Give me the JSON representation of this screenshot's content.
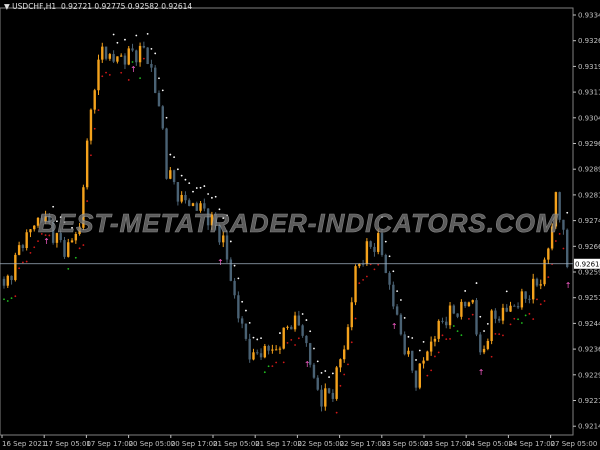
{
  "header": {
    "symbol": "USDCHF,H1",
    "open": "0.92721",
    "high": "0.92775",
    "low": "0.92582",
    "close": "0.92614"
  },
  "watermark": "BEST-METATRADER-INDICATORS.COM",
  "colors": {
    "bull": "#f4a21c",
    "bear": "#4a6274",
    "dot_up": "#ffffff",
    "dot_down": "#d01818",
    "dot_green": "#20c020",
    "signal": "#ff60d0",
    "axis": "#c0c0c0"
  },
  "chart_data": {
    "type": "candlestick",
    "title": "USDCHF,H1",
    "ylim": [
      0.92115,
      0.93365
    ],
    "y_ticks": [
      "0.93340",
      "0.93265",
      "0.93190",
      "0.93115",
      "0.93040",
      "0.92965",
      "0.92890",
      "0.92815",
      "0.92740",
      "0.92665",
      "0.92590",
      "0.92515",
      "0.92440",
      "0.92365",
      "0.92290",
      "0.92215",
      "0.92140"
    ],
    "x_ticks": [
      "16 Sep 2021",
      "17 Sep 05:00",
      "17 Sep 17:00",
      "20 Sep 05:00",
      "20 Sep 17:00",
      "21 Sep 05:00",
      "21 Sep 17:00",
      "22 Sep 05:00",
      "22 Sep 17:00",
      "23 Sep 05:00",
      "23 Sep 17:00",
      "24 Sep 05:00",
      "24 Sep 17:00",
      "27 Sep 05:00"
    ],
    "current_price": "0.92614",
    "bars": 150,
    "close_keypoints": [
      [
        0,
        0.92538
      ],
      [
        5,
        0.92683
      ],
      [
        10,
        0.92756
      ],
      [
        16,
        0.92654
      ],
      [
        20,
        0.92713
      ],
      [
        21,
        0.92859
      ],
      [
        24,
        0.9315
      ],
      [
        26,
        0.93238
      ],
      [
        29,
        0.93209
      ],
      [
        33,
        0.93223
      ],
      [
        37,
        0.93238
      ],
      [
        39,
        0.9318
      ],
      [
        42,
        0.93004
      ],
      [
        43,
        0.92888
      ],
      [
        47,
        0.928
      ],
      [
        53,
        0.92771
      ],
      [
        58,
        0.92683
      ],
      [
        60,
        0.92567
      ],
      [
        63,
        0.92421
      ],
      [
        66,
        0.92333
      ],
      [
        68,
        0.92362
      ],
      [
        72,
        0.92362
      ],
      [
        76,
        0.9245
      ],
      [
        79,
        0.92421
      ],
      [
        82,
        0.92275
      ],
      [
        84,
        0.92217
      ],
      [
        87,
        0.92246
      ],
      [
        91,
        0.92421
      ],
      [
        93,
        0.92596
      ],
      [
        96,
        0.92654
      ],
      [
        99,
        0.92683
      ],
      [
        101,
        0.92596
      ],
      [
        104,
        0.9245
      ],
      [
        107,
        0.92333
      ],
      [
        109,
        0.92275
      ],
      [
        112,
        0.92362
      ],
      [
        116,
        0.9245
      ],
      [
        120,
        0.92479
      ],
      [
        124,
        0.92508
      ],
      [
        126,
        0.92333
      ],
      [
        129,
        0.9245
      ],
      [
        133,
        0.92479
      ],
      [
        137,
        0.92508
      ],
      [
        142,
        0.92567
      ],
      [
        145,
        0.92713
      ],
      [
        146,
        0.92829
      ],
      [
        149,
        0.92614
      ]
    ]
  }
}
